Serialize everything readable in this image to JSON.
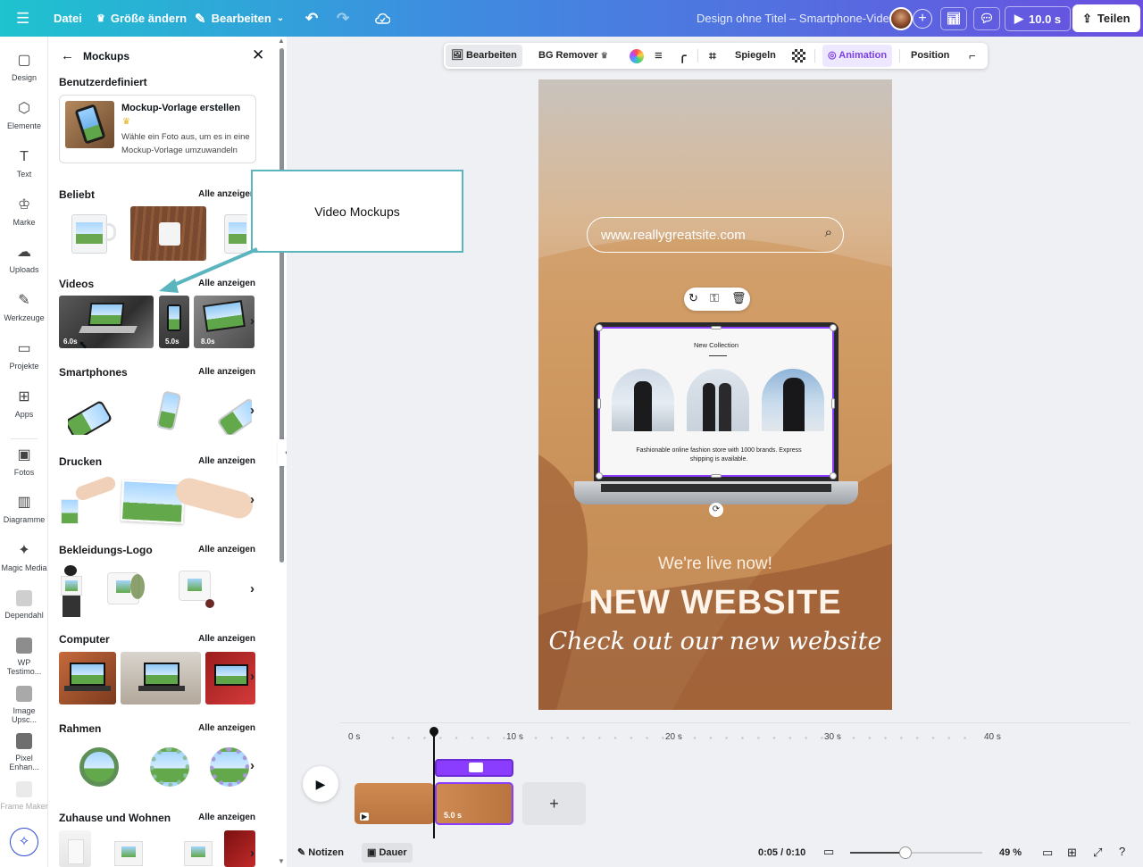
{
  "topbar": {
    "menu_icon": "hamburger-icon",
    "file": "Datei",
    "resize": "Größe ändern",
    "edit": "Bearbeiten",
    "title": "Design ohne Titel – Smartphone-Video",
    "duration": "10.0 s",
    "share": "Teilen"
  },
  "rail": {
    "items": [
      {
        "label": "Design",
        "icon": "design-icon"
      },
      {
        "label": "Elemente",
        "icon": "elements-icon"
      },
      {
        "label": "Text",
        "icon": "text-icon"
      },
      {
        "label": "Marke",
        "icon": "brand-icon"
      },
      {
        "label": "Uploads",
        "icon": "upload-icon"
      },
      {
        "label": "Werkzeuge",
        "icon": "tools-icon"
      },
      {
        "label": "Projekte",
        "icon": "folder-icon"
      },
      {
        "label": "Apps",
        "icon": "apps-icon"
      },
      {
        "label": "Fotos",
        "icon": "photo-icon"
      },
      {
        "label": "Diagramme",
        "icon": "chart-icon"
      },
      {
        "label": "Magic Media",
        "icon": "magic-media-icon"
      },
      {
        "label": "Dependahl",
        "icon": "app-thumb"
      },
      {
        "label": "WP Testimo...",
        "icon": "app-thumb"
      },
      {
        "label": "Image Upsc...",
        "icon": "app-thumb"
      },
      {
        "label": "Pixel Enhan...",
        "icon": "app-thumb"
      },
      {
        "label": "Frame Maker",
        "icon": "app-thumb"
      }
    ]
  },
  "panel": {
    "title": "Mockups",
    "custom_section": "Benutzerdefiniert",
    "custom_card_title": "Mockup-Vorlage erstellen",
    "custom_card_desc": "Wähle ein Foto aus, um es in eine Mockup-Vorlage umzuwandeln",
    "see_all": "Alle anzeigen",
    "sections": [
      "Beliebt",
      "Videos",
      "Smartphones",
      "Drucken",
      "Bekleidungs-Logo",
      "Computer",
      "Rahmen",
      "Zuhause und Wohnen"
    ],
    "video_durations": [
      "6.0s",
      "5.0s",
      "8.0s"
    ]
  },
  "callout": {
    "text": "Video Mockups"
  },
  "toolbar": {
    "edit": "Bearbeiten",
    "bg_remover": "BG Remover",
    "mirror": "Spiegeln",
    "animation": "Animation",
    "position": "Position"
  },
  "design": {
    "url": "www.reallygreatsite.com",
    "screen_title": "New Collection",
    "screen_desc": "Fashionable online fashion store with 1000 brands. Express shipping is available.",
    "live": "We're live now!",
    "headline": "NEW WEBSITE",
    "script": "Check out our new website"
  },
  "timeline": {
    "ticks": [
      "0 s",
      "10 s",
      "20 s",
      "30 s",
      "40 s"
    ],
    "clip_duration": "5.0 s"
  },
  "bottom": {
    "notes": "Notizen",
    "duration": "Dauer",
    "time": "0:05 / 0:10",
    "zoom": "49 %",
    "zoom_level": 0.49
  },
  "colors": {
    "accent": "#8b3dff",
    "teal": "#5bb5bf"
  }
}
